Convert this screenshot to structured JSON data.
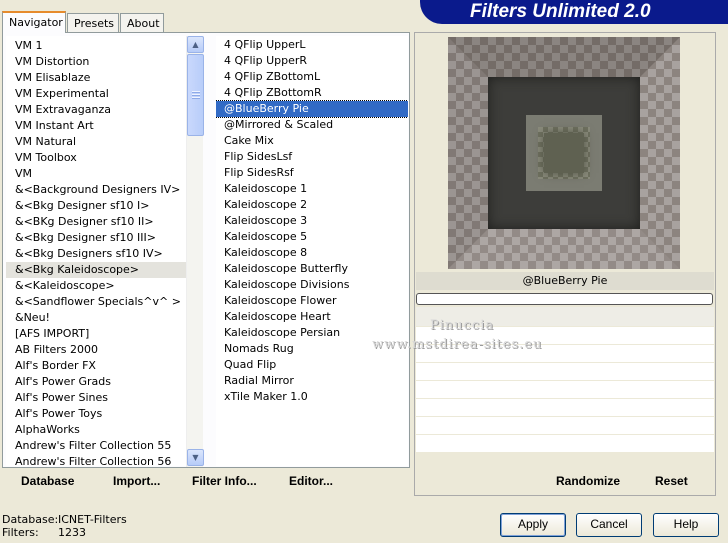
{
  "banner": {
    "title": "Filters Unlimited 2.0"
  },
  "tabs": [
    {
      "label": "Navigator",
      "active": true
    },
    {
      "label": "Presets",
      "active": false
    },
    {
      "label": "About",
      "active": false
    }
  ],
  "categories": [
    "VM 1",
    "VM Distortion",
    "VM Elisablaze",
    "VM Experimental",
    "VM Extravaganza",
    "VM Instant Art",
    "VM Natural",
    "VM Toolbox",
    "VM",
    "&<Background Designers IV>",
    "&<Bkg Designer sf10 I>",
    "&<BKg Designer sf10 II>",
    "&<Bkg Designer sf10 III>",
    "&<Bkg Designers sf10 IV>",
    "&<Bkg Kaleidoscope>",
    "&<Kaleidoscope>",
    "&<Sandflower Specials^v^ >",
    "&Neu!",
    "[AFS IMPORT]",
    "AB Filters 2000",
    "Alf's Border FX",
    "Alf's Power Grads",
    "Alf's Power Sines",
    "Alf's Power Toys",
    "AlphaWorks",
    "Andrew's Filter Collection 55",
    "Andrew's Filter Collection 56"
  ],
  "selected_category": "&<Bkg Kaleidoscope>",
  "filters": [
    "4 QFlip UpperL",
    "4 QFlip UpperR",
    "4 QFlip ZBottomL",
    "4 QFlip ZBottomR",
    "@BlueBerry Pie",
    "@Mirrored & Scaled",
    "Cake Mix",
    "Flip SidesLsf",
    "Flip SidesRsf",
    "Kaleidoscope 1",
    "Kaleidoscope 2",
    "Kaleidoscope 3",
    "Kaleidoscope 5",
    "Kaleidoscope 8",
    "Kaleidoscope Butterfly",
    "Kaleidoscope Divisions",
    "Kaleidoscope Flower",
    "Kaleidoscope Heart",
    "Kaleidoscope Persian",
    "Nomads Rug",
    "Quad Flip",
    "Radial Mirror",
    "xTile Maker 1.0"
  ],
  "selected_filter": "@BlueBerry Pie",
  "bottom_buttons": {
    "database": "Database",
    "import": "Import...",
    "filter_info": "Filter Info...",
    "editor": "Editor..."
  },
  "preview": {
    "filter_name": "@BlueBerry Pie",
    "progress": 0
  },
  "watermark": {
    "line1": "Pinuccia",
    "line2": "www.mstdirea-sites.eu"
  },
  "right_buttons": {
    "randomize": "Randomize",
    "reset": "Reset"
  },
  "status": {
    "database_label": "Database:",
    "database_value": "ICNET-Filters",
    "filters_label": "Filters:",
    "filters_value": "1233"
  },
  "dialog_buttons": {
    "apply": "Apply",
    "cancel": "Cancel",
    "help": "Help"
  },
  "colors": {
    "banner": "#0a1a8c",
    "selection": "#316ac5",
    "tab_accent": "#e68b2c"
  },
  "scrollbar_icons": {
    "up": "chevron-up-icon",
    "down": "chevron-down-icon"
  }
}
